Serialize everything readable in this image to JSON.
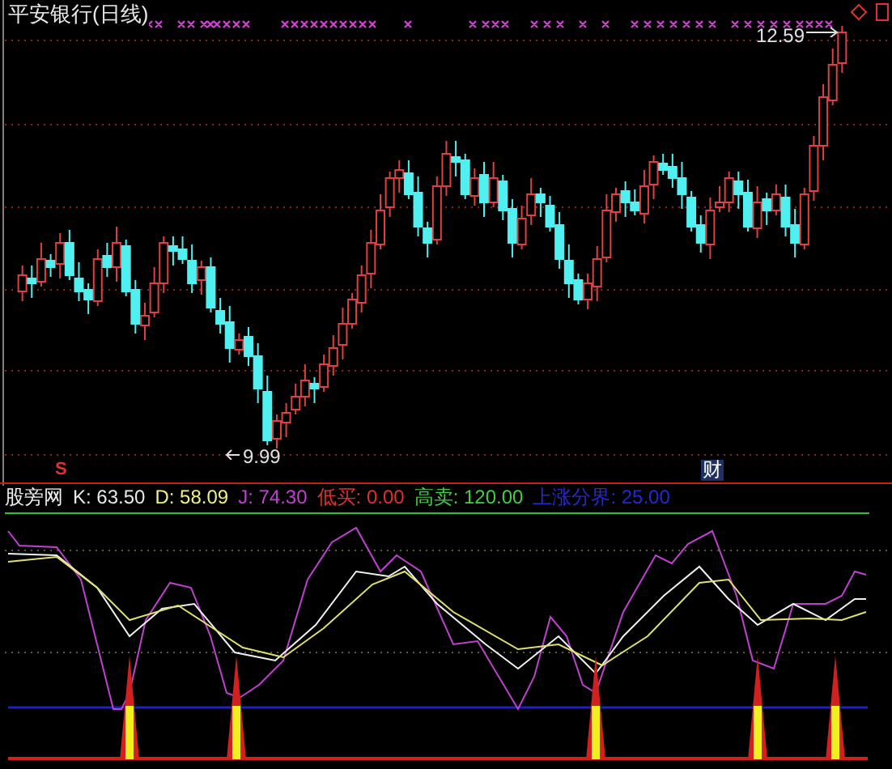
{
  "chart": {
    "title": "平安银行(日线)",
    "high_label": "12.59",
    "low_label": "9.99",
    "markers": [
      {
        "kind": "signal",
        "text": "S"
      },
      {
        "kind": "news",
        "text": "财"
      }
    ]
  },
  "indicator": {
    "name": "股旁网",
    "values": [
      {
        "label": "K: 63.50",
        "color": "#e8e8e8"
      },
      {
        "label": "D: 58.09",
        "color": "#f0f080"
      },
      {
        "label": "J: 74.30",
        "color": "#c040d0"
      },
      {
        "label": "低买: 0.00",
        "color": "#e03030"
      },
      {
        "label": "高卖: 120.00",
        "color": "#40d040"
      },
      {
        "label": "上涨分界: 25.00",
        "color": "#2828d0"
      }
    ]
  }
}
